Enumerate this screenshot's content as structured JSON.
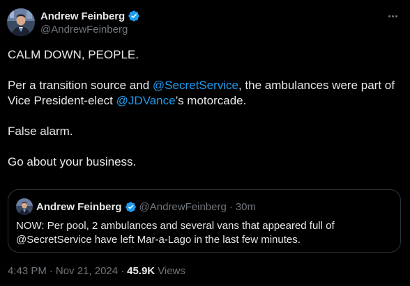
{
  "author": {
    "display_name": "Andrew Feinberg",
    "handle": "@AndrewFeinberg"
  },
  "tweet": {
    "paragraphs": [
      {
        "parts": [
          {
            "text": "CALM DOWN, PEOPLE."
          }
        ]
      },
      {
        "parts": [
          {
            "text": "Per a transition source and "
          },
          {
            "text": "@SecretService",
            "mention": true
          },
          {
            "text": ", the ambulances were part of Vice President-elect "
          },
          {
            "text": "@JDVance",
            "mention": true
          },
          {
            "text": "’s motorcade."
          }
        ]
      },
      {
        "parts": [
          {
            "text": "False alarm."
          }
        ]
      },
      {
        "parts": [
          {
            "text": "Go about your business."
          }
        ]
      }
    ],
    "time": "4:43 PM",
    "date": "Nov 21, 2024",
    "views_count": "45.9K",
    "views_label": "Views",
    "separator": "·"
  },
  "quote": {
    "display_name": "Andrew Feinberg",
    "handle": "@AndrewFeinberg",
    "separator": "·",
    "time": "30m",
    "text": "NOW: Per pool,  2 ambulances and several vans that appeared full of @SecretService have left Mar-a-Lago in the last few minutes."
  },
  "icons": {
    "verified": "verified-badge-icon",
    "more": "more-dots-icon"
  },
  "colors": {
    "background": "#000000",
    "text": "#e7e9ea",
    "muted": "#71767b",
    "accent": "#1d9bf0",
    "border": "#2f3336"
  }
}
